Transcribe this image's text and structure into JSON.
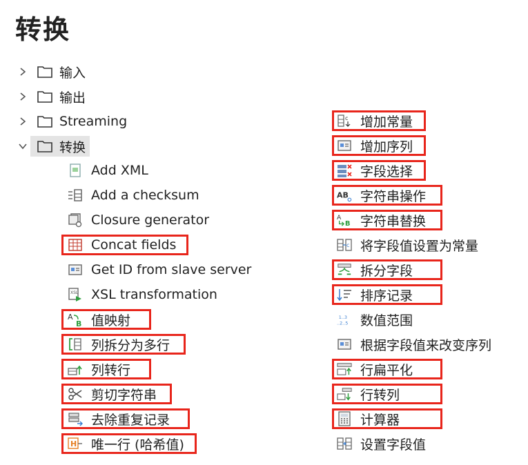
{
  "title": "转换",
  "tree": [
    {
      "label": "输入",
      "expanded": false
    },
    {
      "label": "输出",
      "expanded": false
    },
    {
      "label": "Streaming",
      "expanded": false
    },
    {
      "label": "转换",
      "expanded": true
    }
  ],
  "left_items": [
    {
      "label": "Add XML",
      "icon": "xml-doc-icon"
    },
    {
      "label": "Add a checksum",
      "icon": "checksum-icon"
    },
    {
      "label": "Closure generator",
      "icon": "closure-icon"
    },
    {
      "label": "Concat fields",
      "icon": "grid-icon"
    },
    {
      "label": "Get ID from slave server",
      "icon": "id-card-icon"
    },
    {
      "label": "XSL transformation",
      "icon": "xsl-icon"
    },
    {
      "label": "值映射",
      "icon": "value-mapper-icon"
    },
    {
      "label": "列拆分为多行",
      "icon": "split-rows-icon"
    },
    {
      "label": "列转行",
      "icon": "row-normalise-icon"
    },
    {
      "label": "剪切字符串",
      "icon": "scissors-icon"
    },
    {
      "label": "去除重复记录",
      "icon": "dedupe-icon"
    },
    {
      "label": "唯一行 (哈希值)",
      "icon": "hash-icon"
    }
  ],
  "right_items": [
    {
      "label": "增加常量",
      "icon": "constant-icon"
    },
    {
      "label": "增加序列",
      "icon": "sequence-icon"
    },
    {
      "label": "字段选择",
      "icon": "select-fields-icon"
    },
    {
      "label": "字符串操作",
      "icon": "string-ops-icon"
    },
    {
      "label": "字符串替换",
      "icon": "replace-icon"
    },
    {
      "label": "将字段值设置为常量",
      "icon": "set-constant-icon"
    },
    {
      "label": "拆分字段",
      "icon": "split-field-icon"
    },
    {
      "label": "排序记录",
      "icon": "sort-icon"
    },
    {
      "label": "数值范围",
      "icon": "number-range-icon"
    },
    {
      "label": "根据字段值来改变序列",
      "icon": "change-sequence-icon"
    },
    {
      "label": "行扁平化",
      "icon": "flatten-icon"
    },
    {
      "label": "行转列",
      "icon": "denormalise-icon"
    },
    {
      "label": "计算器",
      "icon": "calculator-icon"
    },
    {
      "label": "设置字段值",
      "icon": "set-value-icon"
    }
  ],
  "colors": {
    "highlight": "#e8251b",
    "selected_row_bg": "#e4e4e4",
    "icon_blue": "#3b7fd1",
    "icon_green": "#2e9e3e",
    "icon_gray": "#777777"
  }
}
